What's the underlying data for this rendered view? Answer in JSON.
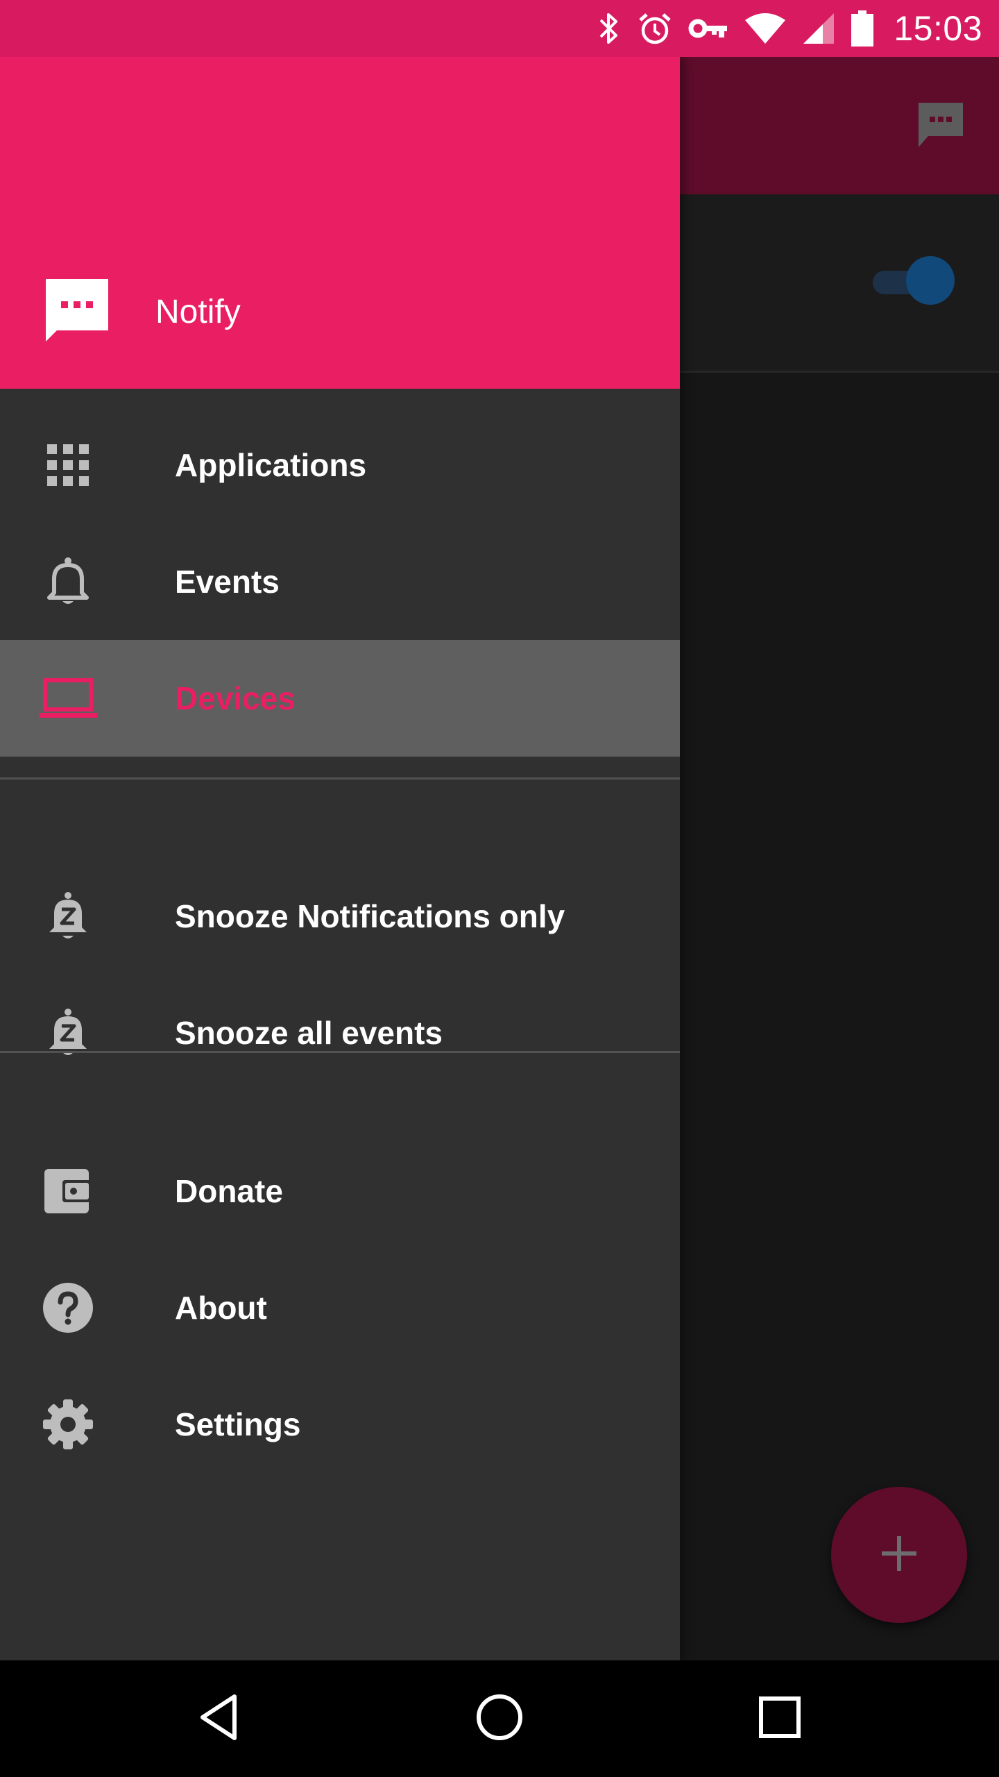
{
  "status_bar": {
    "time": "15:03",
    "icons": [
      "bluetooth-icon",
      "alarm-icon",
      "vpn-key-icon",
      "wifi-icon",
      "cell-signal-icon",
      "battery-icon"
    ],
    "color": "#d81b60"
  },
  "drawer": {
    "header": {
      "app_name": "Notify",
      "icon": "chat-bubble-icon",
      "color": "#e91e63"
    },
    "sections": [
      {
        "items": [
          {
            "label": "Applications",
            "icon": "apps-grid-icon",
            "selected": false
          },
          {
            "label": "Events",
            "icon": "bell-icon",
            "selected": false
          },
          {
            "label": "Devices",
            "icon": "laptop-icon",
            "selected": true
          }
        ]
      },
      {
        "items": [
          {
            "label": "Snooze Notifications only",
            "icon": "snooze-bell-icon",
            "selected": false
          },
          {
            "label": "Snooze all events",
            "icon": "snooze-bell-icon",
            "selected": false
          }
        ]
      },
      {
        "items": [
          {
            "label": "Donate",
            "icon": "wallet-icon",
            "selected": false
          },
          {
            "label": "About",
            "icon": "help-circle-icon",
            "selected": false
          },
          {
            "label": "Settings",
            "icon": "gear-icon",
            "selected": false
          }
        ]
      }
    ],
    "selected_color": "#e91e63"
  },
  "background_screen": {
    "toolbar_icon": "chat-bubble-icon",
    "toggle_on": true,
    "fab_icon": "plus-icon"
  },
  "system_nav": {
    "buttons": [
      "back-icon",
      "home-icon",
      "recents-icon"
    ]
  }
}
